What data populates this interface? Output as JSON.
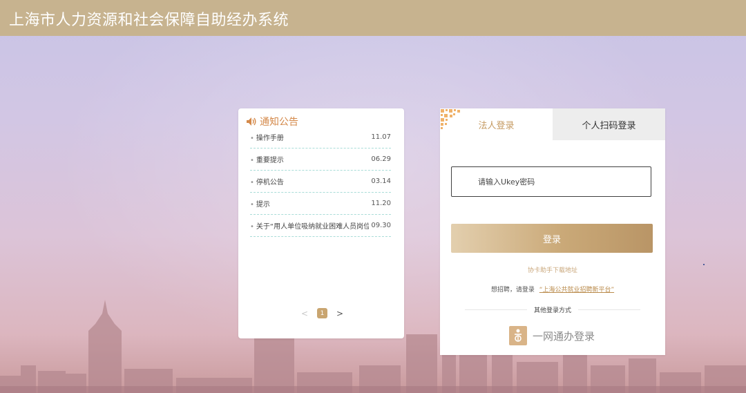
{
  "header": {
    "title": "上海市人力资源和社会保障自助经办系统"
  },
  "notice": {
    "title": "通知公告",
    "items": [
      {
        "text": "操作手册",
        "date": "11.07"
      },
      {
        "text": "重要提示",
        "date": "06.29"
      },
      {
        "text": "停机公告",
        "date": "03.14"
      },
      {
        "text": "提示",
        "date": "11.20"
      },
      {
        "text": "关于“用人单位吸纳就业困难人员岗位...",
        "date": "09.30"
      }
    ],
    "pager": {
      "prev": "<",
      "current": "1",
      "next": ">"
    }
  },
  "login": {
    "tabs": [
      {
        "label": "法人登录",
        "active": true
      },
      {
        "label": "个人扫码登录",
        "active": false
      }
    ],
    "password_placeholder": "请输入Ukey密码",
    "submit_label": "登录",
    "helper_link": "协卡助手下载地址",
    "recruit_prefix": "想招聘，请登录",
    "recruit_link": "“上海公共就业招聘新平台”",
    "other_methods_label": "其他登录方式",
    "yiwang_label": "一网通办登录"
  },
  "colors": {
    "topbar": "#c7b38f",
    "accent_gold": "#c59a62",
    "notice_title": "#d4894a"
  }
}
